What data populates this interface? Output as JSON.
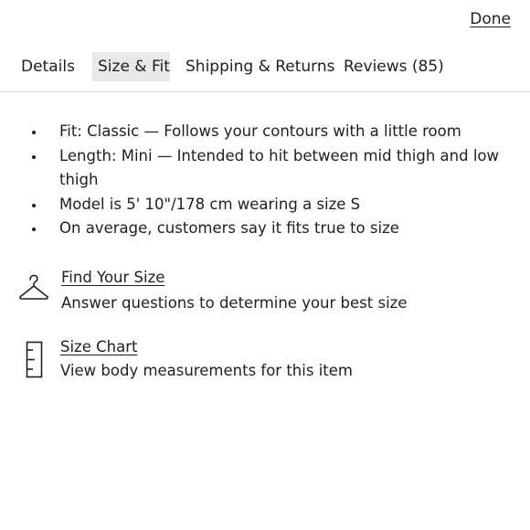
{
  "header": {
    "done_label": "Done"
  },
  "tabs": [
    {
      "label": "Details",
      "active": false
    },
    {
      "label": "Size & Fit",
      "active": true
    },
    {
      "label": "Shipping & Returns",
      "active": false
    },
    {
      "label": "Reviews (85)",
      "active": false
    }
  ],
  "fit_details": [
    "Fit: Classic — Follows your contours with a little room",
    "Length: Mini — Intended to hit between mid thigh and low thigh",
    "Model is 5' 10\"/178 cm wearing a size S",
    "On average, customers say it fits true to size"
  ],
  "find_size": {
    "icon": "hanger-icon",
    "link": "Find Your Size",
    "description": "Answer questions to determine your best size"
  },
  "size_chart": {
    "icon": "ruler-icon",
    "link": "Size Chart",
    "description": "View body measurements for this item"
  },
  "colors": {
    "active_tab_bg": "#e9e9e9",
    "divider": "#dcdcdc",
    "text": "#1f1f1f"
  }
}
